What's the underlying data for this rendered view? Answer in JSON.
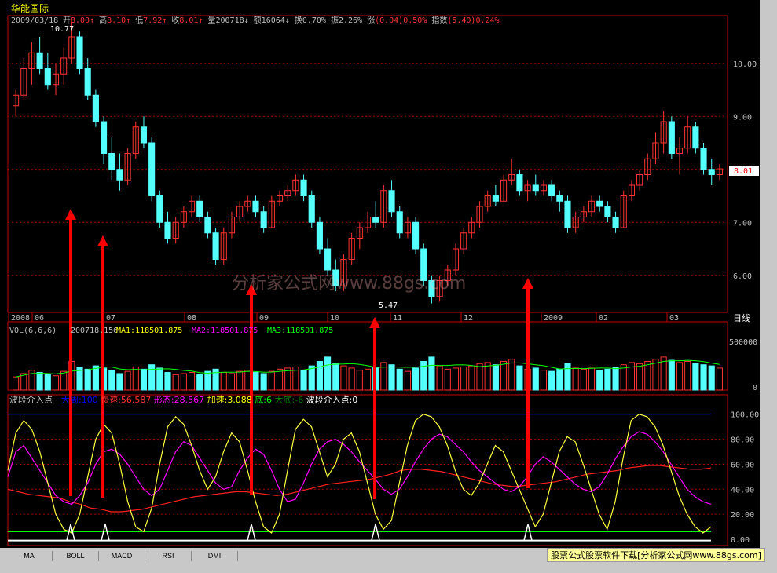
{
  "stock": {
    "name": "华能国际",
    "date": "2009/03/18",
    "quote": [
      {
        "label": "开",
        "value": "8.00",
        "arrow": "↑",
        "color": "#ff3333"
      },
      {
        "label": "高",
        "value": "8.10",
        "arrow": "↑",
        "color": "#ff3333"
      },
      {
        "label": "低",
        "value": "7.92",
        "arrow": "↑",
        "color": "#ff3333"
      },
      {
        "label": "收",
        "value": "8.01",
        "arrow": "↑",
        "color": "#ff3333"
      },
      {
        "label": "量",
        "value": "200718",
        "arrow": "↓",
        "color": "#c0c0c0"
      },
      {
        "label": "额",
        "value": "16064",
        "arrow": "↓",
        "color": "#c0c0c0"
      },
      {
        "label": "换",
        "value": "0.70%",
        "arrow": "",
        "color": "#c0c0c0"
      },
      {
        "label": "振",
        "value": "2.26%",
        "arrow": "",
        "color": "#c0c0c0"
      },
      {
        "label": "涨",
        "value": "(0.04)0.50%",
        "arrow": "",
        "color": "#ff3333"
      },
      {
        "label": "指数",
        "value": "(5.40)0.24%",
        "arrow": "",
        "color": "#ff3333"
      }
    ],
    "last_price": "8.01",
    "high_marker": "10.77",
    "low_marker": "5.47"
  },
  "main_panel": {
    "price_ticks": [
      "10.00",
      "9.00",
      "8.00",
      "7.00",
      "6.00"
    ],
    "price_tick_values": [
      10,
      9,
      8,
      7,
      6
    ],
    "x_labels": [
      "2008",
      "06",
      "07",
      "08",
      "09",
      "10",
      "11",
      "12",
      "2009",
      "02",
      "03"
    ],
    "period": "日线",
    "watermark": "分析家公式网www.88gs.com"
  },
  "vol_panel": {
    "title": "VOL(6,6,6)",
    "value": "200718.156",
    "ma1_label": "MA1:118501.875",
    "ma2_label": "MA2:118501.875",
    "ma3_label": "MA3:118501.875",
    "tick_top": "500000",
    "tick_zero": "0",
    "colors": {
      "ma1": "#ffff00",
      "ma2": "#ff00ff",
      "ma3": "#00ff00"
    }
  },
  "ind_panel": {
    "title": "波段介入点",
    "fields": [
      {
        "label": "大周:100",
        "color": "#0000ff"
      },
      {
        "label": "慢速:56.587",
        "color": "#ff3333"
      },
      {
        "label": "形态:28.567",
        "color": "#ff00ff"
      },
      {
        "label": "加速:3.088",
        "color": "#ffff00"
      },
      {
        "label": "底:6",
        "color": "#00ff00"
      },
      {
        "label": "大底:-6",
        "color": "#008000"
      },
      {
        "label": "波段介入点:0",
        "color": "#ffffff"
      }
    ],
    "ticks": [
      "100.00",
      "80.00",
      "60.00",
      "40.00",
      "20.00",
      "0.00"
    ]
  },
  "tabs": [
    "MA",
    "BOLL",
    "MACD",
    "RSI",
    "DMI"
  ],
  "banner": "股票公式股票软件下载[分析家公式网www.88gs.com]",
  "chart_data": {
    "type": "candlestick",
    "ylim": [
      5.3,
      10.9
    ],
    "candles": [
      [
        9.2,
        9.5,
        9.0,
        9.4
      ],
      [
        9.4,
        10.1,
        9.3,
        9.9
      ],
      [
        9.9,
        10.4,
        9.6,
        10.2
      ],
      [
        10.2,
        10.5,
        9.8,
        9.9
      ],
      [
        9.9,
        10.2,
        9.5,
        9.6
      ],
      [
        9.6,
        10.0,
        9.4,
        9.8
      ],
      [
        9.8,
        10.3,
        9.6,
        10.1
      ],
      [
        10.1,
        10.77,
        10.0,
        10.5
      ],
      [
        10.5,
        10.6,
        9.8,
        9.9
      ],
      [
        9.9,
        10.1,
        9.3,
        9.4
      ],
      [
        9.4,
        9.5,
        8.8,
        8.9
      ],
      [
        8.9,
        9.0,
        8.1,
        8.3
      ],
      [
        8.3,
        8.6,
        7.8,
        8.0
      ],
      [
        8.0,
        8.3,
        7.6,
        7.8
      ],
      [
        7.8,
        8.4,
        7.7,
        8.3
      ],
      [
        8.3,
        8.9,
        8.2,
        8.8
      ],
      [
        8.8,
        9.0,
        8.4,
        8.5
      ],
      [
        8.5,
        8.6,
        7.4,
        7.5
      ],
      [
        7.5,
        7.6,
        6.9,
        7.0
      ],
      [
        7.0,
        7.2,
        6.6,
        6.7
      ],
      [
        6.7,
        7.1,
        6.6,
        7.0
      ],
      [
        7.0,
        7.3,
        6.9,
        7.2
      ],
      [
        7.2,
        7.5,
        7.1,
        7.4
      ],
      [
        7.4,
        7.5,
        7.0,
        7.1
      ],
      [
        7.1,
        7.2,
        6.7,
        6.8
      ],
      [
        6.8,
        6.9,
        6.2,
        6.3
      ],
      [
        6.3,
        6.9,
        6.2,
        6.8
      ],
      [
        6.8,
        7.2,
        6.7,
        7.1
      ],
      [
        7.1,
        7.4,
        7.0,
        7.3
      ],
      [
        7.3,
        7.5,
        7.2,
        7.4
      ],
      [
        7.4,
        7.5,
        7.1,
        7.2
      ],
      [
        7.2,
        7.3,
        6.8,
        6.9
      ],
      [
        6.9,
        7.5,
        6.9,
        7.4
      ],
      [
        7.4,
        7.6,
        7.3,
        7.5
      ],
      [
        7.5,
        7.7,
        7.4,
        7.6
      ],
      [
        7.6,
        7.9,
        7.5,
        7.8
      ],
      [
        7.8,
        7.9,
        7.4,
        7.5
      ],
      [
        7.5,
        7.6,
        6.9,
        7.0
      ],
      [
        7.0,
        7.1,
        6.4,
        6.5
      ],
      [
        6.5,
        6.7,
        6.0,
        6.1
      ],
      [
        6.1,
        6.3,
        5.7,
        5.8
      ],
      [
        5.8,
        6.4,
        5.7,
        6.3
      ],
      [
        6.3,
        6.8,
        6.2,
        6.7
      ],
      [
        6.7,
        7.0,
        6.5,
        6.9
      ],
      [
        6.9,
        7.2,
        6.8,
        7.1
      ],
      [
        7.1,
        7.4,
        6.9,
        7.0
      ],
      [
        7.0,
        7.7,
        6.9,
        7.6
      ],
      [
        7.6,
        7.8,
        7.1,
        7.2
      ],
      [
        7.2,
        7.3,
        6.7,
        6.8
      ],
      [
        6.8,
        7.1,
        6.7,
        7.0
      ],
      [
        7.0,
        7.1,
        6.4,
        6.5
      ],
      [
        6.5,
        6.6,
        5.8,
        5.9
      ],
      [
        5.9,
        6.0,
        5.47,
        5.6
      ],
      [
        5.6,
        6.0,
        5.5,
        5.9
      ],
      [
        5.9,
        6.2,
        5.8,
        6.1
      ],
      [
        6.1,
        6.6,
        6.0,
        6.5
      ],
      [
        6.5,
        6.9,
        6.4,
        6.8
      ],
      [
        6.8,
        7.1,
        6.7,
        7.0
      ],
      [
        7.0,
        7.4,
        6.9,
        7.3
      ],
      [
        7.3,
        7.6,
        7.2,
        7.5
      ],
      [
        7.5,
        7.7,
        7.3,
        7.4
      ],
      [
        7.4,
        7.9,
        7.4,
        7.8
      ],
      [
        7.8,
        8.2,
        7.7,
        7.9
      ],
      [
        7.9,
        8.0,
        7.5,
        7.6
      ],
      [
        7.6,
        7.8,
        7.4,
        7.7
      ],
      [
        7.7,
        7.9,
        7.5,
        7.6
      ],
      [
        7.6,
        7.8,
        7.5,
        7.7
      ],
      [
        7.7,
        7.8,
        7.4,
        7.5
      ],
      [
        7.5,
        7.6,
        7.2,
        7.4
      ],
      [
        7.4,
        7.5,
        6.8,
        6.9
      ],
      [
        6.9,
        7.2,
        6.8,
        7.1
      ],
      [
        7.1,
        7.3,
        7.0,
        7.2
      ],
      [
        7.2,
        7.5,
        7.1,
        7.4
      ],
      [
        7.4,
        7.5,
        7.2,
        7.3
      ],
      [
        7.3,
        7.4,
        7.0,
        7.1
      ],
      [
        7.1,
        7.2,
        6.8,
        6.9
      ],
      [
        6.9,
        7.6,
        6.9,
        7.5
      ],
      [
        7.5,
        7.8,
        7.4,
        7.7
      ],
      [
        7.7,
        8.0,
        7.6,
        7.9
      ],
      [
        7.9,
        8.3,
        7.8,
        8.2
      ],
      [
        8.2,
        8.7,
        8.1,
        8.5
      ],
      [
        8.5,
        9.1,
        8.3,
        8.9
      ],
      [
        8.9,
        9.0,
        8.2,
        8.3
      ],
      [
        8.3,
        8.6,
        7.9,
        8.4
      ],
      [
        8.4,
        9.0,
        8.3,
        8.8
      ],
      [
        8.8,
        8.9,
        8.3,
        8.4
      ],
      [
        8.4,
        8.5,
        7.9,
        8.0
      ],
      [
        8.0,
        8.2,
        7.7,
        7.9
      ],
      [
        7.9,
        8.1,
        7.8,
        8.01
      ]
    ],
    "volume": [
      120,
      150,
      180,
      160,
      140,
      130,
      170,
      260,
      210,
      190,
      220,
      200,
      180,
      150,
      170,
      210,
      190,
      230,
      200,
      160,
      140,
      150,
      160,
      140,
      170,
      190,
      160,
      150,
      170,
      180,
      160,
      150,
      170,
      190,
      200,
      210,
      180,
      220,
      260,
      300,
      240,
      220,
      200,
      180,
      190,
      210,
      250,
      230,
      190,
      170,
      200,
      260,
      300,
      220,
      190,
      200,
      210,
      220,
      240,
      250,
      230,
      260,
      280,
      220,
      190,
      200,
      180,
      170,
      190,
      240,
      200,
      190,
      200,
      180,
      190,
      210,
      230,
      250,
      240,
      260,
      280,
      300,
      270,
      250,
      260,
      240,
      230,
      220,
      200
    ],
    "slow": [
      40,
      38,
      36,
      35,
      34,
      33,
      30,
      28,
      25,
      24,
      22,
      22,
      23,
      24,
      26,
      28,
      30,
      32,
      34,
      35,
      36,
      37,
      38,
      38,
      37,
      36,
      35,
      36,
      38,
      40,
      42,
      44,
      45,
      46,
      47,
      48,
      50,
      52,
      55,
      56,
      56,
      55,
      54,
      52,
      50,
      48,
      46,
      44,
      43,
      42,
      43,
      44,
      45,
      46,
      48,
      50,
      52,
      53,
      54,
      55,
      57,
      58,
      59,
      59,
      58,
      57,
      56,
      56,
      57
    ],
    "shape": [
      50,
      70,
      75,
      65,
      55,
      45,
      35,
      30,
      28,
      35,
      45,
      60,
      70,
      72,
      68,
      60,
      50,
      40,
      35,
      40,
      55,
      70,
      78,
      75,
      65,
      55,
      45,
      40,
      42,
      55,
      65,
      72,
      68,
      55,
      40,
      30,
      32,
      45,
      60,
      72,
      78,
      80,
      76,
      70,
      62,
      55,
      48,
      40,
      36,
      40,
      50,
      62,
      72,
      80,
      84,
      82,
      76,
      70,
      62,
      55,
      50,
      45,
      40,
      38,
      42,
      50,
      60,
      66,
      62,
      56,
      50,
      44,
      40,
      38,
      42,
      52,
      64,
      74,
      82,
      86,
      84,
      78,
      70,
      60,
      50,
      40,
      34,
      30,
      28
    ],
    "speed": [
      55,
      85,
      95,
      88,
      70,
      45,
      20,
      8,
      5,
      20,
      50,
      80,
      92,
      85,
      60,
      30,
      10,
      6,
      25,
      60,
      90,
      98,
      92,
      75,
      55,
      40,
      50,
      70,
      85,
      78,
      55,
      30,
      10,
      5,
      20,
      55,
      88,
      96,
      90,
      70,
      50,
      60,
      80,
      85,
      70,
      45,
      20,
      8,
      15,
      45,
      75,
      95,
      100,
      98,
      90,
      75,
      55,
      40,
      35,
      45,
      60,
      75,
      70,
      55,
      40,
      25,
      10,
      20,
      45,
      70,
      82,
      78,
      60,
      40,
      20,
      8,
      30,
      65,
      95,
      100,
      98,
      90,
      75,
      55,
      35,
      20,
      10,
      5,
      10
    ]
  }
}
